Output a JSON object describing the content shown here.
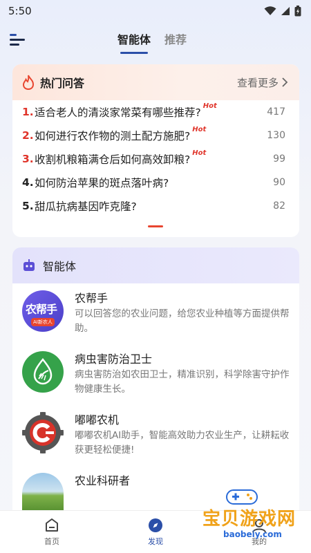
{
  "status_bar": {
    "time": "5:50"
  },
  "tabs": [
    {
      "label": "智能体",
      "active": true
    },
    {
      "label": "推荐",
      "active": false
    }
  ],
  "hot_qa": {
    "title": "热门问答",
    "more_label": "查看更多",
    "hot_tag": "Hot",
    "items": [
      {
        "num": "1.",
        "text": "适合老人的清淡家常菜有哪些推荐?",
        "hot": true,
        "count": "417",
        "color": "#e0342a"
      },
      {
        "num": "2.",
        "text": "如何进行农作物的测土配方施肥?",
        "hot": true,
        "count": "130",
        "color": "#e0342a"
      },
      {
        "num": "3.",
        "text": "收割机粮箱满仓后如何高效卸粮?",
        "hot": true,
        "count": "99",
        "color": "#e0342a"
      },
      {
        "num": "4.",
        "text": "如何防治苹果的斑点落叶病?",
        "hot": false,
        "count": "90",
        "color": "#222222"
      },
      {
        "num": "5.",
        "text": "甜瓜抗病基因咋克隆?",
        "hot": false,
        "count": "82",
        "color": "#222222"
      }
    ]
  },
  "agents": {
    "title": "智能体",
    "items": [
      {
        "name": "农帮手",
        "desc": "可以回答您的农业问题，给您农业种植等方面提供帮助。",
        "avatar_text": "农帮手",
        "avatar_sub": "AI新农人",
        "icon": "nongbangshou-logo"
      },
      {
        "name": "病虫害防治卫士",
        "desc": "病虫害防治如农田卫士，精准识别，科学除害守护作物健康生长。",
        "icon": "leaf-drop-icon"
      },
      {
        "name": "嘟嘟农机",
        "desc": "嘟嘟农机AI助手，智能高效助力农业生产，让耕耘收获更轻松便捷!",
        "icon": "gear-c-icon"
      },
      {
        "name": "农业科研者",
        "desc": "",
        "icon": "field-photo"
      }
    ]
  },
  "bottom_nav": [
    {
      "label": "首页",
      "icon": "home-icon",
      "active": false
    },
    {
      "label": "发现",
      "icon": "compass-icon",
      "active": true
    },
    {
      "label": "我的",
      "icon": "profile-icon",
      "active": false
    }
  ],
  "watermark": {
    "text": "宝贝游戏网",
    "url": "baobeiy.com"
  },
  "colors": {
    "accent": "#2b4fa8",
    "hot_red": "#e0342a",
    "pager": "#e8452f"
  }
}
